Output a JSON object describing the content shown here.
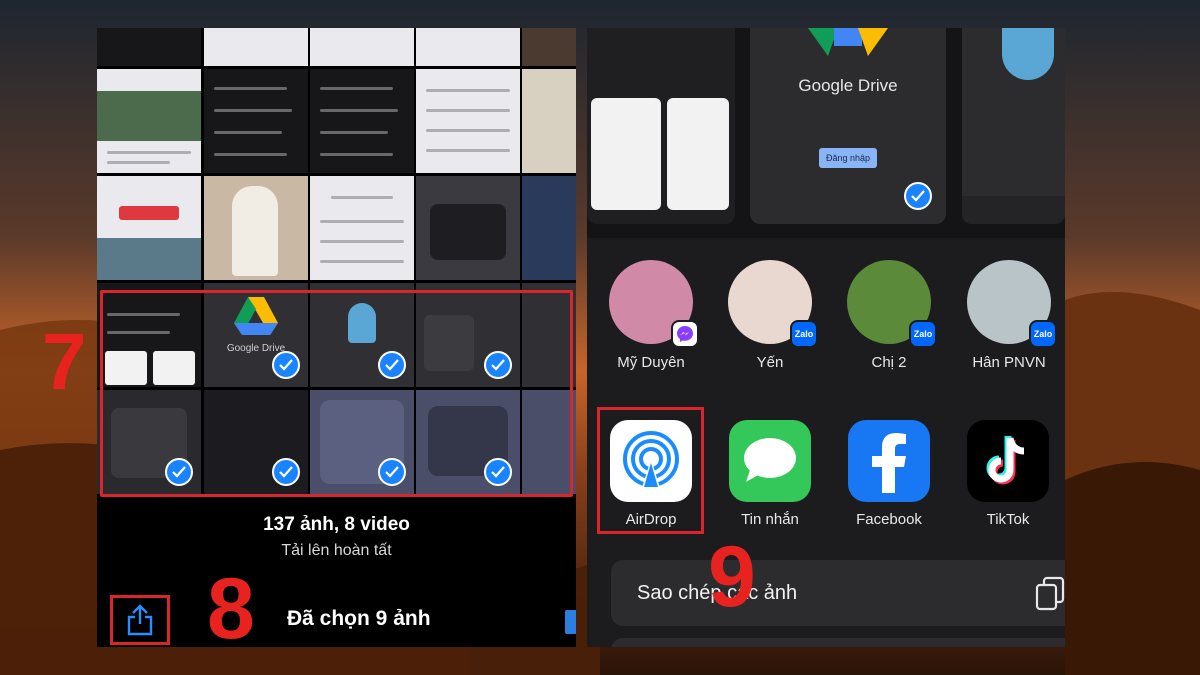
{
  "steps": {
    "seven": "7",
    "eight": "8",
    "nine": "9"
  },
  "photos": {
    "count_text": "137 ảnh, 8 video",
    "upload_status": "Tải lên hoàn tất",
    "selected_text": "Đã chọn 9 ảnh",
    "tile_google_drive": "Google Drive"
  },
  "share_sheet": {
    "google_drive_label": "Google Drive",
    "login_label": "Đăng nhập",
    "contacts": [
      {
        "name": "Mỹ Duyên",
        "app": "messenger-icon"
      },
      {
        "name": "Yến",
        "app": "zalo-icon",
        "badge": "Zalo"
      },
      {
        "name": "Chị 2",
        "app": "zalo-icon",
        "badge": "Zalo"
      },
      {
        "name": "Hân PNVN",
        "app": "zalo-icon",
        "badge": "Zalo"
      }
    ],
    "apps": [
      {
        "name": "AirDrop",
        "icon": "airdrop-icon"
      },
      {
        "name": "Tin nhắn",
        "icon": "messages-icon"
      },
      {
        "name": "Facebook",
        "icon": "facebook-icon"
      },
      {
        "name": "TikTok",
        "icon": "tiktok-icon"
      }
    ],
    "copy_action": "Sao chép các ảnh"
  },
  "colors": {
    "highlight": "#d9262c",
    "check_blue": "#1a84ff",
    "messages_green": "#34c759",
    "facebook_blue": "#1877f2",
    "zalo_blue": "#0068ff"
  }
}
